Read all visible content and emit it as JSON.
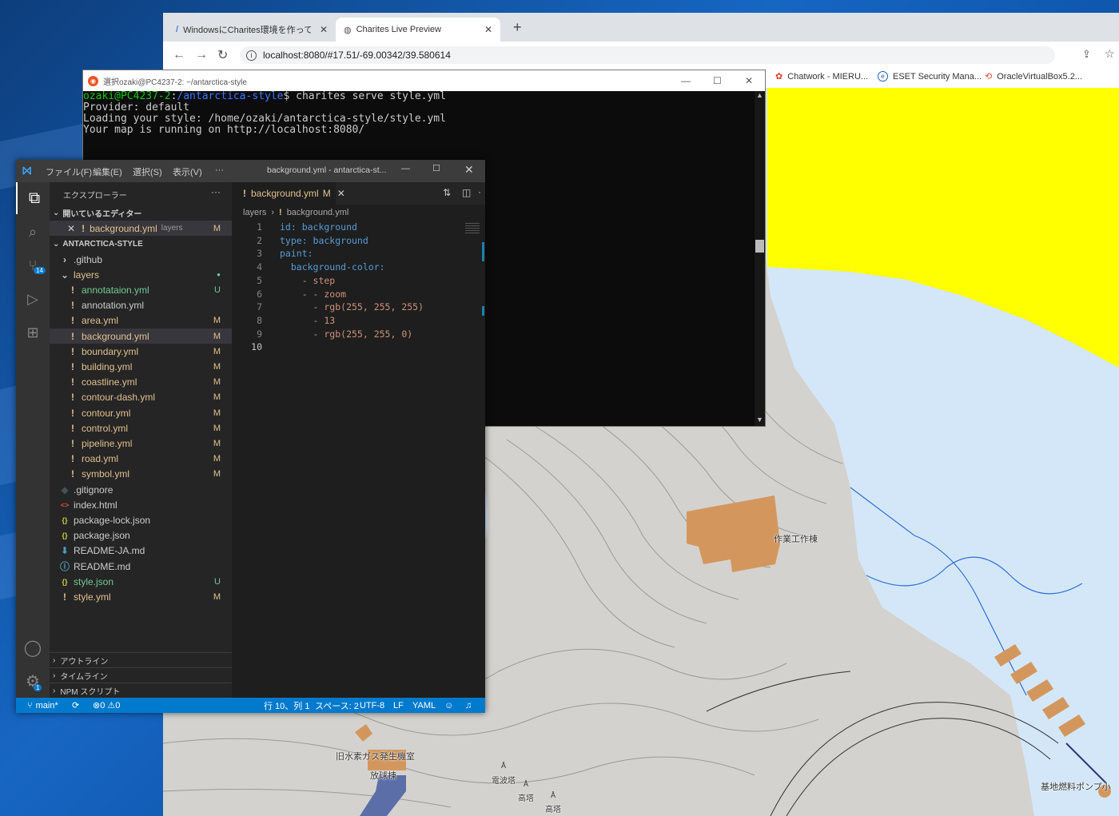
{
  "browser": {
    "tabs": [
      {
        "title": "WindowsにCharites環境を作ってみ",
        "active": false
      },
      {
        "title": "Charites Live Preview",
        "active": true
      }
    ],
    "new_tab": "+",
    "url": "localhost:8080/#17.51/-69.00342/39.580614",
    "bookmarks": [
      "Chatwork - MIERU...",
      "ESET Security Mana...",
      "OracleVirtualBox5.2..."
    ]
  },
  "map": {
    "labels": [
      "作業工作棟",
      "旧水素ガス発生機室",
      "放球棟",
      "電波塔",
      "高塔",
      "高塔",
      "基地燃料ポンプ小"
    ],
    "colors": {
      "background": "#d4d2ce",
      "water": "#d4e7f9",
      "highlight": "#ffff00",
      "building": "#d3975e",
      "road": "#5c6ea8"
    }
  },
  "terminal": {
    "title": "選択ozaki@PC4237-2: ~/antarctica-style",
    "prompt_user": "ozaki@PC4237-2",
    "prompt_path": "/antarctica-style",
    "command": "charites serve style.yml",
    "output": [
      "Provider: default",
      "Loading your style: /home/ozaki/antarctica-style/style.yml",
      "Your map is running on http://localhost:8080/"
    ]
  },
  "vscode": {
    "menu": [
      "ファイル(F)",
      "編集(E)",
      "選択(S)",
      "表示(V)",
      "···"
    ],
    "window_title": "background.yml - antarctica-st...",
    "explorer_title": "エクスプローラー",
    "open_editors_label": "開いているエディター",
    "open_editor": {
      "name": "background.yml",
      "dir": "layers",
      "status": "M"
    },
    "project_label": "ANTARCTICA-STYLE",
    "files": [
      {
        "name": ".github",
        "kind": "folder-closed",
        "status": "",
        "indent": 0
      },
      {
        "name": "layers",
        "kind": "folder-open",
        "status": "●",
        "indent": 0
      },
      {
        "name": "annotataion.yml",
        "kind": "yml",
        "status": "U",
        "indent": 1
      },
      {
        "name": "annotation.yml",
        "kind": "yml",
        "status": "",
        "indent": 1
      },
      {
        "name": "area.yml",
        "kind": "yml",
        "status": "M",
        "indent": 1
      },
      {
        "name": "background.yml",
        "kind": "yml",
        "status": "M",
        "indent": 1
      },
      {
        "name": "boundary.yml",
        "kind": "yml",
        "status": "M",
        "indent": 1
      },
      {
        "name": "building.yml",
        "kind": "yml",
        "status": "M",
        "indent": 1
      },
      {
        "name": "coastline.yml",
        "kind": "yml",
        "status": "M",
        "indent": 1
      },
      {
        "name": "contour-dash.yml",
        "kind": "yml",
        "status": "M",
        "indent": 1
      },
      {
        "name": "contour.yml",
        "kind": "yml",
        "status": "M",
        "indent": 1
      },
      {
        "name": "control.yml",
        "kind": "yml",
        "status": "M",
        "indent": 1
      },
      {
        "name": "pipeline.yml",
        "kind": "yml",
        "status": "M",
        "indent": 1
      },
      {
        "name": "road.yml",
        "kind": "yml",
        "status": "M",
        "indent": 1
      },
      {
        "name": "symbol.yml",
        "kind": "yml",
        "status": "M",
        "indent": 1
      },
      {
        "name": ".gitignore",
        "kind": "git",
        "status": "",
        "indent": 0
      },
      {
        "name": "index.html",
        "kind": "html",
        "status": "",
        "indent": 0
      },
      {
        "name": "package-lock.json",
        "kind": "json",
        "status": "",
        "indent": 0
      },
      {
        "name": "package.json",
        "kind": "json",
        "status": "",
        "indent": 0
      },
      {
        "name": "README-JA.md",
        "kind": "md",
        "status": "",
        "indent": 0
      },
      {
        "name": "README.md",
        "kind": "info",
        "status": "",
        "indent": 0
      },
      {
        "name": "style.json",
        "kind": "json",
        "status": "U",
        "indent": 0
      },
      {
        "name": "style.yml",
        "kind": "yml",
        "status": "M",
        "indent": 0
      }
    ],
    "bottom_sections": [
      "アウトライン",
      "タイムライン",
      "NPM スクリプト"
    ],
    "editor_tab": {
      "name": "background.yml",
      "status": "M"
    },
    "breadcrumb": [
      "layers",
      "background.yml"
    ],
    "code_lines": [
      "id: background",
      "type: background",
      "paint:",
      "  background-color:",
      "    - step",
      "    - - zoom",
      "      - rgb(255, 255, 255)",
      "      - 13",
      "      - rgb(255, 255, 0)",
      ""
    ],
    "scm_badge": "14",
    "settings_badge": "1",
    "status": {
      "branch": "main*",
      "errors": "0",
      "warnings": "0",
      "position": "行 10、列 1",
      "spaces": "スペース: 2",
      "encoding": "UTF-8",
      "eol": "LF",
      "language": "YAML"
    }
  }
}
